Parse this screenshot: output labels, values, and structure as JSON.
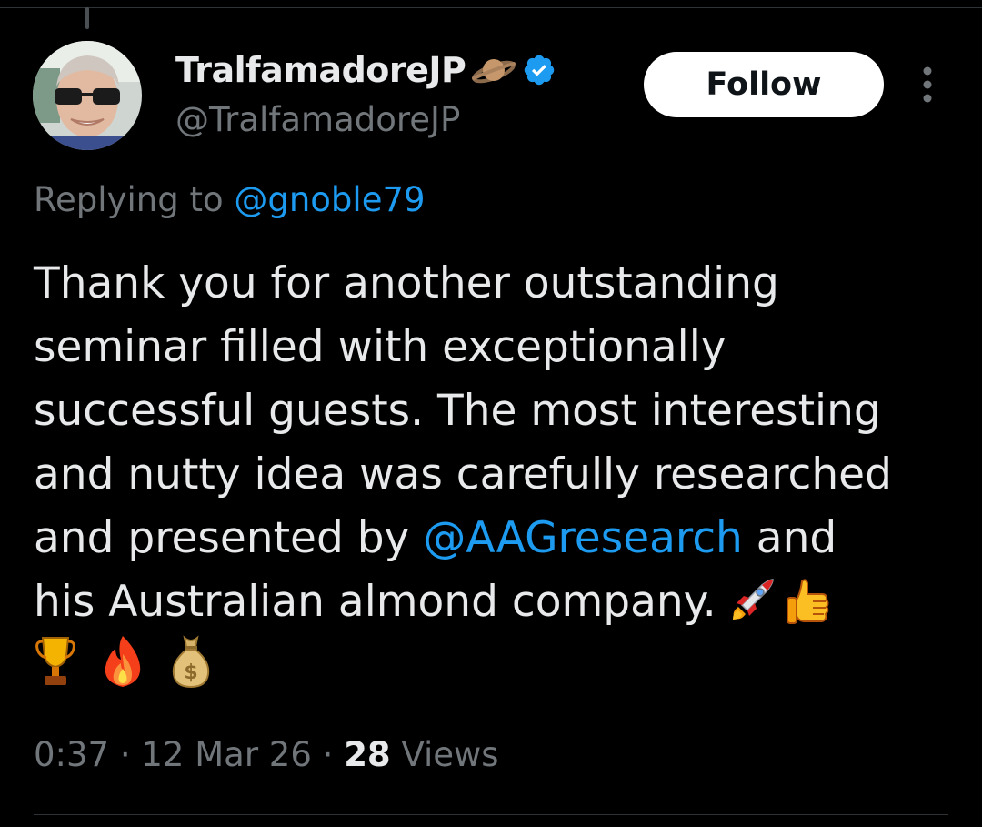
{
  "author": {
    "display_name": "TralfamadoreJP",
    "handle": "@TralfamadoreJP",
    "name_emoji": "saturn-ringed-planet-icon",
    "verified_badge": "verified-badge-icon"
  },
  "follow_button": {
    "label": "Follow"
  },
  "more_menu": {
    "icon": "more-vertical-icon"
  },
  "reply": {
    "prefix": "Replying to ",
    "mention": "@gnoble79"
  },
  "tweet": {
    "line1": "Thank you for another outstanding",
    "line2": "seminar filled with exceptionally",
    "line3": "successful guests. The most interesting",
    "line4": "and nutty idea was carefully researched",
    "line5_pre": "and presented by ",
    "line5_mention": "@AAGresearch",
    "line5_post": " and",
    "line6": "his Australian almond company.",
    "emojis": [
      "rocket-icon",
      "thumbs-up-icon",
      "trophy-icon",
      "fire-icon",
      "money-bag-icon"
    ]
  },
  "meta": {
    "time": "0:37",
    "separator": " · ",
    "date": "12 Mar 26",
    "views_count": "28",
    "views_label": " Views"
  },
  "colors": {
    "background": "#000000",
    "text": "#e7e9ea",
    "secondary": "#71767b",
    "link": "#1d9bf0"
  }
}
